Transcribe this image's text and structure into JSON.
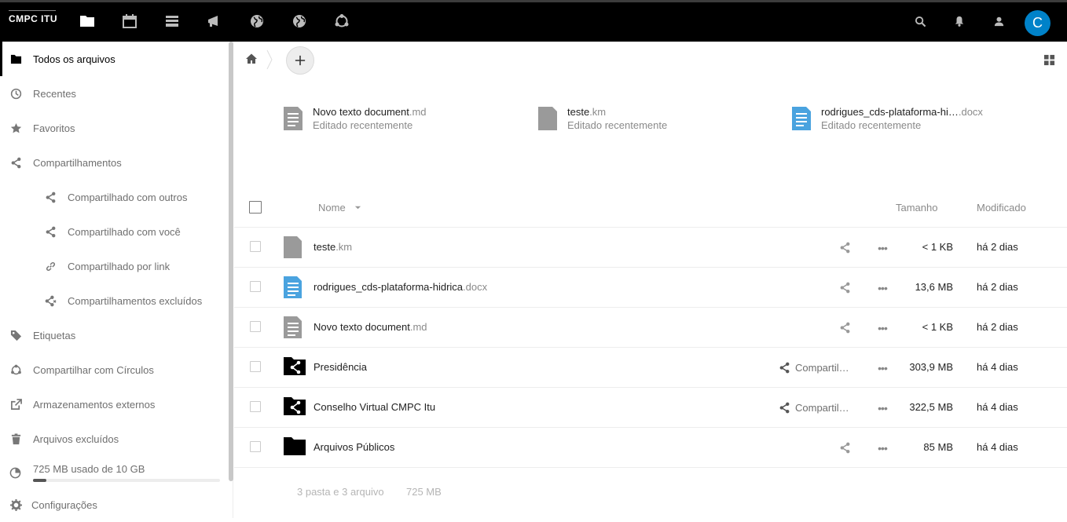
{
  "header": {
    "logo": "CMPC ITU",
    "apps": [
      "files-icon",
      "calendar-icon",
      "deck-icon",
      "announcements-icon",
      "globe-icon",
      "globe-icon",
      "circles-icon"
    ],
    "right": [
      "search-icon",
      "bell-icon",
      "contacts-icon"
    ],
    "avatar_letter": "C"
  },
  "sidebar": {
    "items": [
      {
        "label": "Todos os arquivos"
      },
      {
        "label": "Recentes"
      },
      {
        "label": "Favoritos"
      },
      {
        "label": "Compartilhamentos"
      },
      {
        "label": "Compartilhado com outros"
      },
      {
        "label": "Compartilhado com você"
      },
      {
        "label": "Compartilhado por link"
      },
      {
        "label": "Compartilhamentos excluídos"
      },
      {
        "label": "Etiquetas"
      },
      {
        "label": "Compartilhar com Círculos"
      },
      {
        "label": "Armazenamentos externos"
      },
      {
        "label": "Arquivos excluídos"
      }
    ],
    "quota": {
      "label": "725 MB usado de 10 GB",
      "used_fraction": 0.07
    },
    "settings": "Configurações"
  },
  "recent": [
    {
      "name": "Novo texto document",
      "ext": ".md",
      "sub": "Editado recentemente"
    },
    {
      "name": "teste",
      "ext": ".km",
      "sub": "Editado recentemente"
    },
    {
      "name": "rodrigues_cds-plataforma-hi…",
      "ext": ".docx",
      "sub": "Editado recentemente"
    }
  ],
  "table": {
    "headers": {
      "name": "Nome",
      "size": "Tamanho",
      "modified": "Modificado"
    },
    "rows": [
      {
        "name": "teste",
        "ext": ".km",
        "share": "",
        "size": "< 1 KB",
        "modified": "há 2 dias"
      },
      {
        "name": "rodrigues_cds-plataforma-hidrica",
        "ext": ".docx",
        "share": "",
        "size": "13,6 MB",
        "modified": "há 2 dias"
      },
      {
        "name": "Novo texto document",
        "ext": ".md",
        "share": "",
        "size": "< 1 KB",
        "modified": "há 2 dias"
      },
      {
        "name": "Presidência",
        "ext": "",
        "share": "Compartil…",
        "size": "303,9 MB",
        "modified": "há 4 dias"
      },
      {
        "name": "Conselho Virtual CMPC Itu",
        "ext": "",
        "share": "Compartil…",
        "size": "322,5 MB",
        "modified": "há 4 dias"
      },
      {
        "name": "Arquivos Públicos",
        "ext": "",
        "share": "",
        "size": "85 MB",
        "modified": "há 4 dias"
      }
    ],
    "summary": {
      "count": "3 pasta e 3 arquivo",
      "size": "725 MB"
    }
  },
  "colors": {
    "accent": "#0082c9",
    "header": "#000000",
    "docx_icon": "#4aa3df",
    "file_icon": "#969696"
  }
}
